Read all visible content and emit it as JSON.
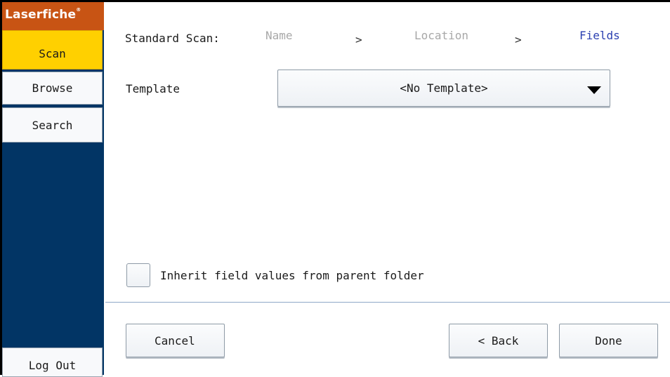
{
  "sidebar": {
    "logo": "Laserfiche",
    "logo_mark": "®",
    "items": [
      {
        "label": "Scan"
      },
      {
        "label": "Browse"
      },
      {
        "label": "Search"
      }
    ],
    "logout_label": "Log Out"
  },
  "header": {
    "title": "Standard Scan:",
    "steps": [
      {
        "label": "Name"
      },
      {
        "label": "Location"
      },
      {
        "label": "Fields"
      }
    ],
    "separator": ">"
  },
  "template": {
    "label": "Template",
    "value": "<No Template>"
  },
  "inherit": {
    "label": "Inherit field values from parent folder"
  },
  "footer": {
    "cancel_label": "Cancel",
    "back_label": "< Back",
    "done_label": "Done"
  }
}
